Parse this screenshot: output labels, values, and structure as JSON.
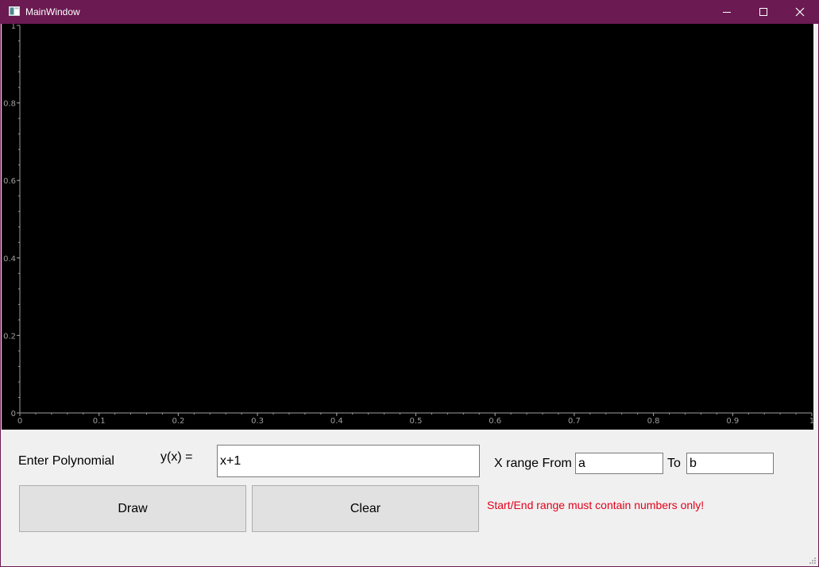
{
  "window": {
    "title": "MainWindow",
    "icon": "app-window-icon",
    "controls": [
      "minimize-icon",
      "maximize-icon",
      "close-icon"
    ],
    "titlebar_color": "#6b1a52"
  },
  "plot": {
    "background": "#000000",
    "x_ticks": [
      "0",
      "0.1",
      "0.2",
      "0.3",
      "0.4",
      "0.5",
      "0.6",
      "0.7",
      "0.8",
      "0.9",
      "1"
    ],
    "y_ticks": [
      "0",
      "0.2",
      "0.4",
      "0.6",
      "0.8",
      "1"
    ],
    "xlim": [
      0,
      1
    ],
    "ylim": [
      0,
      1
    ]
  },
  "form": {
    "enter_polynomial_label": "Enter Polynomial",
    "yx_label": "y(x) =",
    "polynomial_value": "x+1",
    "x_range_from_label": "X range From",
    "from_value": "a",
    "to_label": "To",
    "to_value": "b",
    "draw_label": "Draw",
    "clear_label": "Clear",
    "error_message": "Start/End range must contain numbers only!",
    "error_color": "#e3001b"
  }
}
